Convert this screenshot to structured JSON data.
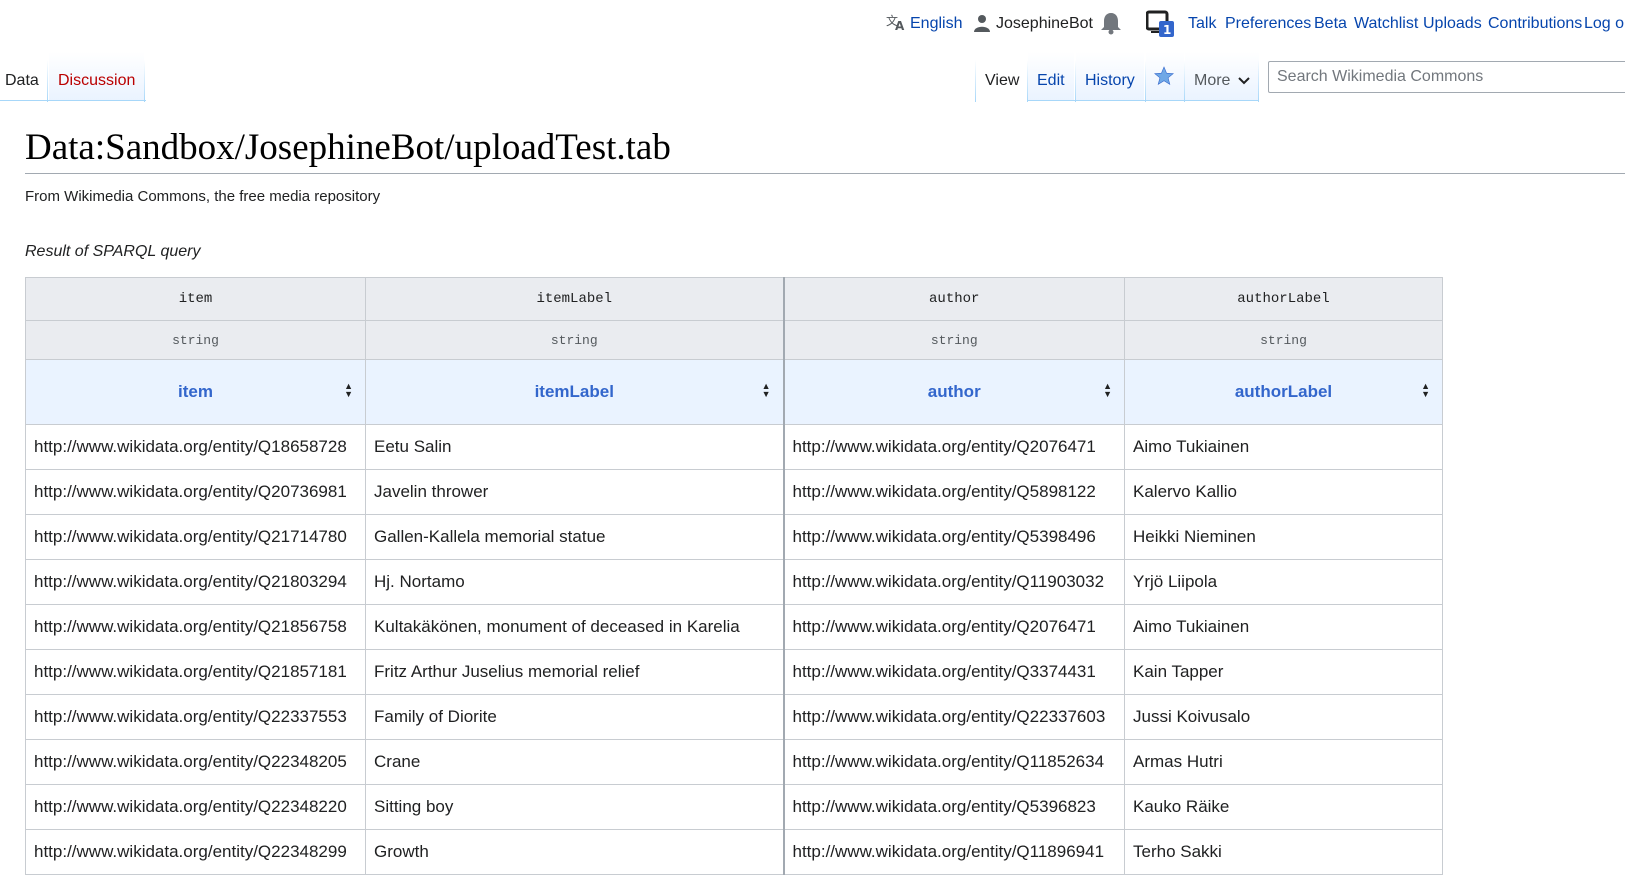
{
  "personal": {
    "language": "English",
    "username": "JosephineBot",
    "notice_count": "1",
    "links": [
      "Talk",
      "Preferences",
      "Beta",
      "Watchlist",
      "Uploads",
      "Contributions",
      "Log out"
    ]
  },
  "tabs": {
    "namespace": "Data",
    "discussion": "Discussion",
    "view": "View",
    "edit": "Edit",
    "history": "History",
    "more": "More"
  },
  "search": {
    "placeholder": "Search Wikimedia Commons"
  },
  "page": {
    "title": "Data:Sandbox/JosephineBot/uploadTest.tab",
    "tagline": "From Wikimedia Commons, the free media repository",
    "caption": "Result of SPARQL query"
  },
  "table": {
    "field_names": [
      "item",
      "itemLabel",
      "author",
      "authorLabel"
    ],
    "field_types": [
      "string",
      "string",
      "string",
      "string"
    ],
    "column_titles": [
      "item",
      "itemLabel",
      "author",
      "authorLabel"
    ],
    "rows": [
      [
        "http://www.wikidata.org/entity/Q18658728",
        "Eetu Salin",
        "http://www.wikidata.org/entity/Q2076471",
        "Aimo Tukiainen"
      ],
      [
        "http://www.wikidata.org/entity/Q20736981",
        "Javelin thrower",
        "http://www.wikidata.org/entity/Q5898122",
        "Kalervo Kallio"
      ],
      [
        "http://www.wikidata.org/entity/Q21714780",
        "Gallen-Kallela memorial statue",
        "http://www.wikidata.org/entity/Q5398496",
        "Heikki Nieminen"
      ],
      [
        "http://www.wikidata.org/entity/Q21803294",
        "Hj. Nortamo",
        "http://www.wikidata.org/entity/Q11903032",
        "Yrjö Liipola"
      ],
      [
        "http://www.wikidata.org/entity/Q21856758",
        "Kultakäkönen, monument of deceased in Karelia",
        "http://www.wikidata.org/entity/Q2076471",
        "Aimo Tukiainen"
      ],
      [
        "http://www.wikidata.org/entity/Q21857181",
        "Fritz Arthur Juselius memorial relief",
        "http://www.wikidata.org/entity/Q3374431",
        "Kain Tapper"
      ],
      [
        "http://www.wikidata.org/entity/Q22337553",
        "Family of Diorite",
        "http://www.wikidata.org/entity/Q22337603",
        "Jussi Koivusalo"
      ],
      [
        "http://www.wikidata.org/entity/Q22348205",
        "Crane",
        "http://www.wikidata.org/entity/Q11852634",
        "Armas Hutri"
      ],
      [
        "http://www.wikidata.org/entity/Q22348220",
        "Sitting boy",
        "http://www.wikidata.org/entity/Q5396823",
        "Kauko Räike"
      ],
      [
        "http://www.wikidata.org/entity/Q22348299",
        "Growth",
        "http://www.wikidata.org/entity/Q11896941",
        "Terho Sakki"
      ]
    ]
  }
}
